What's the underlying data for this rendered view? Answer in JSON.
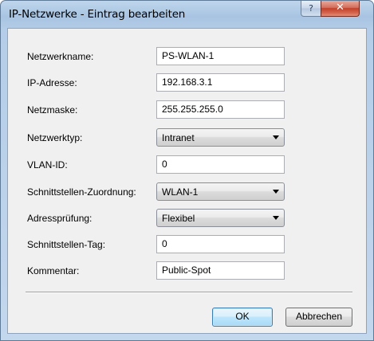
{
  "window": {
    "title": "IP-Netzwerke - Eintrag bearbeiten",
    "help_label": "?",
    "close_label": "✕"
  },
  "form": {
    "network_name": {
      "label": "Netzwerkname:",
      "value": "PS-WLAN-1"
    },
    "ip_address": {
      "label": "IP-Adresse:",
      "value": "192.168.3.1"
    },
    "netmask": {
      "label": "Netzmaske:",
      "value": "255.255.255.0"
    },
    "network_type": {
      "label": "Netzwerktyp:",
      "value": "Intranet"
    },
    "vlan_id": {
      "label": "VLAN-ID:",
      "value": "0"
    },
    "interface_assignment": {
      "label": "Schnittstellen-Zuordnung:",
      "value": "WLAN-1"
    },
    "address_check": {
      "label": "Adressprüfung:",
      "value": "Flexibel"
    },
    "interface_tag": {
      "label": "Schnittstellen-Tag:",
      "value": "0"
    },
    "comment": {
      "label": "Kommentar:",
      "value": "Public-Spot"
    }
  },
  "buttons": {
    "ok": "OK",
    "cancel": "Abbrechen"
  }
}
